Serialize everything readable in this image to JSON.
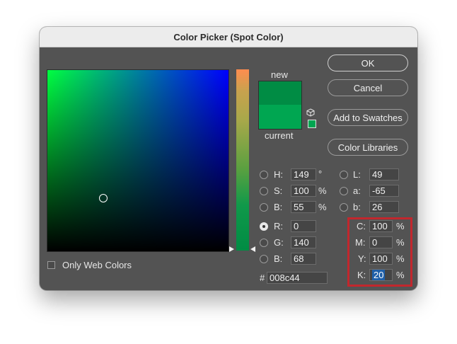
{
  "window": {
    "title": "Color Picker (Spot Color)"
  },
  "preview": {
    "new_label": "new",
    "current_label": "current",
    "new_color": "#008c44",
    "current_color": "#00a651"
  },
  "buttons": {
    "ok": "OK",
    "cancel": "Cancel",
    "add_to_swatches": "Add to Swatches",
    "color_libraries": "Color Libraries"
  },
  "hsb": {
    "h": {
      "label": "H:",
      "value": "149",
      "unit": "°"
    },
    "s": {
      "label": "S:",
      "value": "100",
      "unit": "%"
    },
    "b": {
      "label": "B:",
      "value": "55",
      "unit": "%"
    }
  },
  "rgb": {
    "r": {
      "label": "R:",
      "value": "0"
    },
    "g": {
      "label": "G:",
      "value": "140"
    },
    "b": {
      "label": "B:",
      "value": "68"
    }
  },
  "lab": {
    "l": {
      "label": "L:",
      "value": "49"
    },
    "a": {
      "label": "a:",
      "value": "-65"
    },
    "b": {
      "label": "b:",
      "value": "26"
    }
  },
  "cmyk": {
    "c": {
      "label": "C:",
      "value": "100",
      "unit": "%"
    },
    "m": {
      "label": "M:",
      "value": "0",
      "unit": "%"
    },
    "y": {
      "label": "Y:",
      "value": "100",
      "unit": "%"
    },
    "k": {
      "label": "K:",
      "value": "20",
      "unit": "%"
    }
  },
  "hex": {
    "label": "#",
    "value": "008c44"
  },
  "options": {
    "only_web_colors": "Only Web Colors"
  },
  "selected_mode": "R"
}
